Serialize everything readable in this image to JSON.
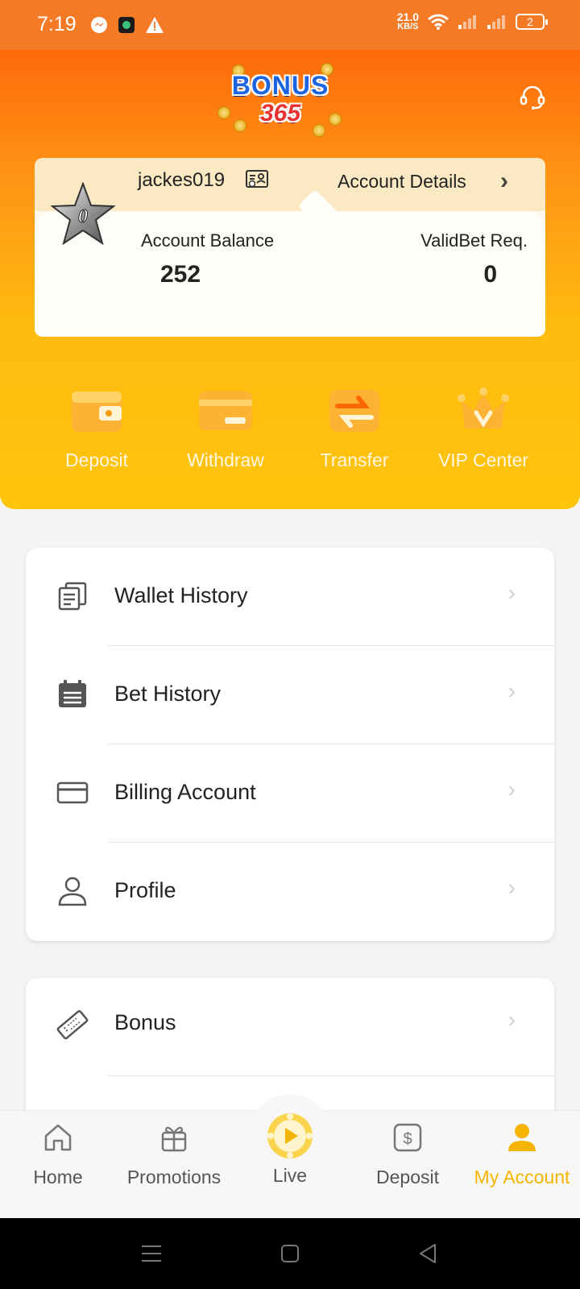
{
  "status_bar": {
    "time": "7:19",
    "speed_value": "21.0",
    "speed_unit": "KB/S",
    "battery": "2"
  },
  "header": {
    "logo_word": "BONUS",
    "logo_number": "365"
  },
  "account": {
    "username": "jackes019",
    "details_label": "Account Details",
    "balance_label": "Account Balance",
    "balance_value": "252",
    "validbet_label": "ValidBet Req.",
    "validbet_value": "0",
    "vip_level": "0"
  },
  "quick_actions": [
    {
      "label": "Deposit",
      "icon": "wallet-icon"
    },
    {
      "label": "Withdraw",
      "icon": "card-icon"
    },
    {
      "label": "Transfer",
      "icon": "transfer-icon"
    },
    {
      "label": "VIP Center",
      "icon": "crown-icon"
    }
  ],
  "menu_group_1": [
    {
      "label": "Wallet History",
      "icon": "documents-icon"
    },
    {
      "label": "Bet History",
      "icon": "calendar-icon"
    },
    {
      "label": "Billing Account",
      "icon": "credit-card-icon"
    },
    {
      "label": "Profile",
      "icon": "user-icon"
    }
  ],
  "menu_group_2": [
    {
      "label": "Bonus",
      "icon": "ticket-icon"
    }
  ],
  "bottom_nav": [
    {
      "label": "Home",
      "icon": "home-icon"
    },
    {
      "label": "Promotions",
      "icon": "gift-icon"
    },
    {
      "label": "Live",
      "icon": "play-icon"
    },
    {
      "label": "Deposit",
      "icon": "dollar-icon"
    },
    {
      "label": "My Account",
      "icon": "account-icon",
      "active": true
    }
  ],
  "colors": {
    "header_top": "#fe6a0b",
    "header_bottom": "#ffc40c",
    "accent": "#f5b400"
  }
}
